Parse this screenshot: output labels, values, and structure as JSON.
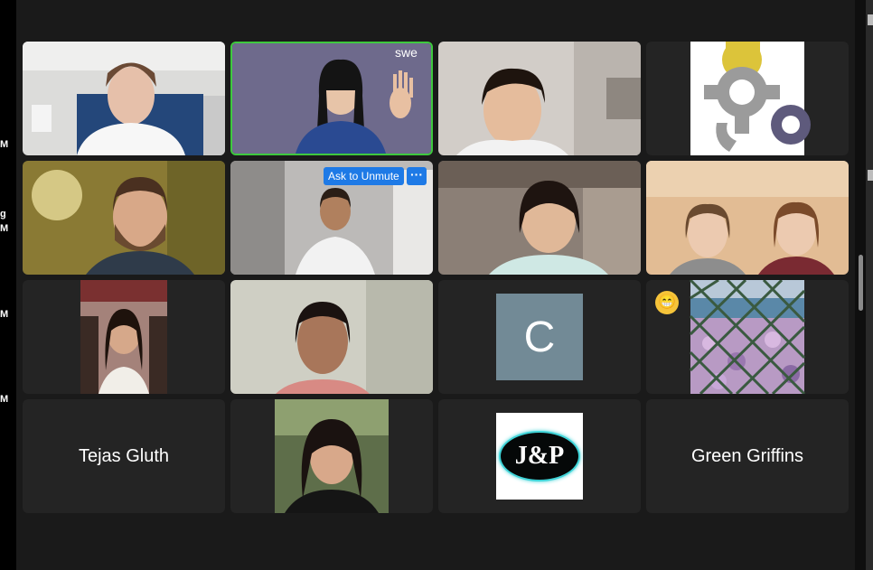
{
  "chat_marks": [
    "M",
    "g",
    "M",
    "M",
    "M"
  ],
  "rows": [
    [
      {
        "type": "video"
      },
      {
        "type": "video",
        "active": true,
        "logo": "swe"
      },
      {
        "type": "video"
      },
      {
        "type": "image",
        "icon": "gears-logo"
      }
    ],
    [
      {
        "type": "video"
      },
      {
        "type": "video",
        "controls": {
          "ask_to_unmute": "Ask to Unmute",
          "more": "···"
        }
      },
      {
        "type": "video"
      },
      {
        "type": "video"
      }
    ],
    [
      {
        "type": "video"
      },
      {
        "type": "video"
      },
      {
        "type": "avatar",
        "initial": "C"
      },
      {
        "type": "image",
        "icon": "fence-flowers",
        "reaction": "😁"
      }
    ],
    [
      {
        "type": "name",
        "name": "Tejas Gluth"
      },
      {
        "type": "video"
      },
      {
        "type": "logo",
        "text": "J&P"
      },
      {
        "type": "name",
        "name": "Green Griffins"
      }
    ]
  ],
  "colors": {
    "active_border": "#3ec93e",
    "button_blue": "#1e7ae6",
    "tile_bg": "#242424",
    "gallery_bg": "#1a1a1a",
    "avatar_bg": "#728a96"
  }
}
